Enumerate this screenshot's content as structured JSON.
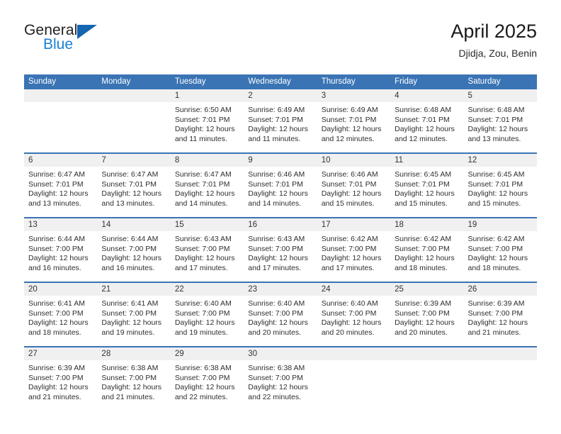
{
  "brand": {
    "name_part1": "General",
    "name_part2": "Blue",
    "accent_color": "#1a7fd4",
    "triangle_color": "#1565b0"
  },
  "header": {
    "title": "April 2025",
    "subtitle": "Djidja, Zou, Benin",
    "header_bg_color": "#3a74b4"
  },
  "calendar": {
    "weekday_headers": [
      "Sunday",
      "Monday",
      "Tuesday",
      "Wednesday",
      "Thursday",
      "Friday",
      "Saturday"
    ],
    "weeks": [
      [
        {
          "day": "",
          "empty": true
        },
        {
          "day": "",
          "empty": true
        },
        {
          "day": "1",
          "sunrise": "Sunrise: 6:50 AM",
          "sunset": "Sunset: 7:01 PM",
          "daylight": "Daylight: 12 hours and 11 minutes."
        },
        {
          "day": "2",
          "sunrise": "Sunrise: 6:49 AM",
          "sunset": "Sunset: 7:01 PM",
          "daylight": "Daylight: 12 hours and 11 minutes."
        },
        {
          "day": "3",
          "sunrise": "Sunrise: 6:49 AM",
          "sunset": "Sunset: 7:01 PM",
          "daylight": "Daylight: 12 hours and 12 minutes."
        },
        {
          "day": "4",
          "sunrise": "Sunrise: 6:48 AM",
          "sunset": "Sunset: 7:01 PM",
          "daylight": "Daylight: 12 hours and 12 minutes."
        },
        {
          "day": "5",
          "sunrise": "Sunrise: 6:48 AM",
          "sunset": "Sunset: 7:01 PM",
          "daylight": "Daylight: 12 hours and 13 minutes."
        }
      ],
      [
        {
          "day": "6",
          "sunrise": "Sunrise: 6:47 AM",
          "sunset": "Sunset: 7:01 PM",
          "daylight": "Daylight: 12 hours and 13 minutes."
        },
        {
          "day": "7",
          "sunrise": "Sunrise: 6:47 AM",
          "sunset": "Sunset: 7:01 PM",
          "daylight": "Daylight: 12 hours and 13 minutes."
        },
        {
          "day": "8",
          "sunrise": "Sunrise: 6:47 AM",
          "sunset": "Sunset: 7:01 PM",
          "daylight": "Daylight: 12 hours and 14 minutes."
        },
        {
          "day": "9",
          "sunrise": "Sunrise: 6:46 AM",
          "sunset": "Sunset: 7:01 PM",
          "daylight": "Daylight: 12 hours and 14 minutes."
        },
        {
          "day": "10",
          "sunrise": "Sunrise: 6:46 AM",
          "sunset": "Sunset: 7:01 PM",
          "daylight": "Daylight: 12 hours and 15 minutes."
        },
        {
          "day": "11",
          "sunrise": "Sunrise: 6:45 AM",
          "sunset": "Sunset: 7:01 PM",
          "daylight": "Daylight: 12 hours and 15 minutes."
        },
        {
          "day": "12",
          "sunrise": "Sunrise: 6:45 AM",
          "sunset": "Sunset: 7:01 PM",
          "daylight": "Daylight: 12 hours and 15 minutes."
        }
      ],
      [
        {
          "day": "13",
          "sunrise": "Sunrise: 6:44 AM",
          "sunset": "Sunset: 7:00 PM",
          "daylight": "Daylight: 12 hours and 16 minutes."
        },
        {
          "day": "14",
          "sunrise": "Sunrise: 6:44 AM",
          "sunset": "Sunset: 7:00 PM",
          "daylight": "Daylight: 12 hours and 16 minutes."
        },
        {
          "day": "15",
          "sunrise": "Sunrise: 6:43 AM",
          "sunset": "Sunset: 7:00 PM",
          "daylight": "Daylight: 12 hours and 17 minutes."
        },
        {
          "day": "16",
          "sunrise": "Sunrise: 6:43 AM",
          "sunset": "Sunset: 7:00 PM",
          "daylight": "Daylight: 12 hours and 17 minutes."
        },
        {
          "day": "17",
          "sunrise": "Sunrise: 6:42 AM",
          "sunset": "Sunset: 7:00 PM",
          "daylight": "Daylight: 12 hours and 17 minutes."
        },
        {
          "day": "18",
          "sunrise": "Sunrise: 6:42 AM",
          "sunset": "Sunset: 7:00 PM",
          "daylight": "Daylight: 12 hours and 18 minutes."
        },
        {
          "day": "19",
          "sunrise": "Sunrise: 6:42 AM",
          "sunset": "Sunset: 7:00 PM",
          "daylight": "Daylight: 12 hours and 18 minutes."
        }
      ],
      [
        {
          "day": "20",
          "sunrise": "Sunrise: 6:41 AM",
          "sunset": "Sunset: 7:00 PM",
          "daylight": "Daylight: 12 hours and 18 minutes."
        },
        {
          "day": "21",
          "sunrise": "Sunrise: 6:41 AM",
          "sunset": "Sunset: 7:00 PM",
          "daylight": "Daylight: 12 hours and 19 minutes."
        },
        {
          "day": "22",
          "sunrise": "Sunrise: 6:40 AM",
          "sunset": "Sunset: 7:00 PM",
          "daylight": "Daylight: 12 hours and 19 minutes."
        },
        {
          "day": "23",
          "sunrise": "Sunrise: 6:40 AM",
          "sunset": "Sunset: 7:00 PM",
          "daylight": "Daylight: 12 hours and 20 minutes."
        },
        {
          "day": "24",
          "sunrise": "Sunrise: 6:40 AM",
          "sunset": "Sunset: 7:00 PM",
          "daylight": "Daylight: 12 hours and 20 minutes."
        },
        {
          "day": "25",
          "sunrise": "Sunrise: 6:39 AM",
          "sunset": "Sunset: 7:00 PM",
          "daylight": "Daylight: 12 hours and 20 minutes."
        },
        {
          "day": "26",
          "sunrise": "Sunrise: 6:39 AM",
          "sunset": "Sunset: 7:00 PM",
          "daylight": "Daylight: 12 hours and 21 minutes."
        }
      ],
      [
        {
          "day": "27",
          "sunrise": "Sunrise: 6:39 AM",
          "sunset": "Sunset: 7:00 PM",
          "daylight": "Daylight: 12 hours and 21 minutes."
        },
        {
          "day": "28",
          "sunrise": "Sunrise: 6:38 AM",
          "sunset": "Sunset: 7:00 PM",
          "daylight": "Daylight: 12 hours and 21 minutes."
        },
        {
          "day": "29",
          "sunrise": "Sunrise: 6:38 AM",
          "sunset": "Sunset: 7:00 PM",
          "daylight": "Daylight: 12 hours and 22 minutes."
        },
        {
          "day": "30",
          "sunrise": "Sunrise: 6:38 AM",
          "sunset": "Sunset: 7:00 PM",
          "daylight": "Daylight: 12 hours and 22 minutes."
        },
        {
          "day": "",
          "empty": true
        },
        {
          "day": "",
          "empty": true
        },
        {
          "day": "",
          "empty": true
        }
      ]
    ]
  }
}
